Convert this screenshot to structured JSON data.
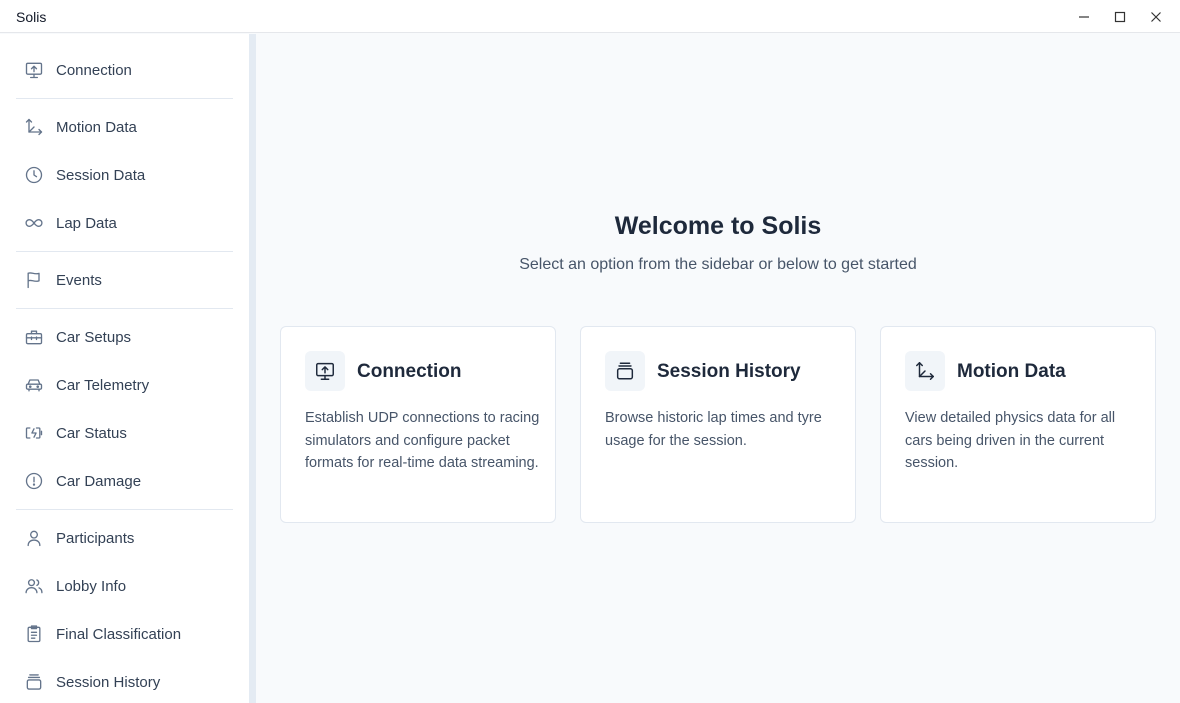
{
  "window": {
    "title": "Solis",
    "controls": {
      "minimize": "minimize-icon",
      "maximize": "maximize-icon",
      "close": "close-icon"
    }
  },
  "sidebar": {
    "items": [
      {
        "label": "Connection",
        "icon": "monitor-upload-icon"
      },
      {
        "label": "Motion Data",
        "icon": "axes-arrow-icon"
      },
      {
        "label": "Session Data",
        "icon": "clock-icon"
      },
      {
        "label": "Lap Data",
        "icon": "infinity-icon"
      },
      {
        "label": "Events",
        "icon": "flag-icon"
      },
      {
        "label": "Car Setups",
        "icon": "toolbox-icon"
      },
      {
        "label": "Car Telemetry",
        "icon": "car-icon"
      },
      {
        "label": "Car Status",
        "icon": "battery-charging-icon"
      },
      {
        "label": "Car Damage",
        "icon": "alert-circle-icon"
      },
      {
        "label": "Participants",
        "icon": "user-icon"
      },
      {
        "label": "Lobby Info",
        "icon": "users-icon"
      },
      {
        "label": "Final Classification",
        "icon": "clipboard-list-icon"
      },
      {
        "label": "Session History",
        "icon": "stack-icon"
      }
    ]
  },
  "main": {
    "title": "Welcome to Solis",
    "subtitle": "Select an option from the sidebar or below to get started",
    "cards": [
      {
        "title": "Connection",
        "description": "Establish UDP connections to racing simulators and configure packet formats for real-time data streaming.",
        "icon": "monitor-upload-icon"
      },
      {
        "title": "Session History",
        "description": "Browse historic lap times and tyre usage for the session.",
        "icon": "stack-icon"
      },
      {
        "title": "Motion Data",
        "description": "View detailed physics data for all cars being driven in the current session.",
        "icon": "axes-arrow-icon"
      }
    ]
  },
  "colors": {
    "sidebar_bg": "#ffffff",
    "main_bg": "#f8fafc",
    "sidebar_edge": "#e4ebf3",
    "text_primary": "#1e293b",
    "text_secondary": "#475569",
    "icon": "#64748b"
  }
}
